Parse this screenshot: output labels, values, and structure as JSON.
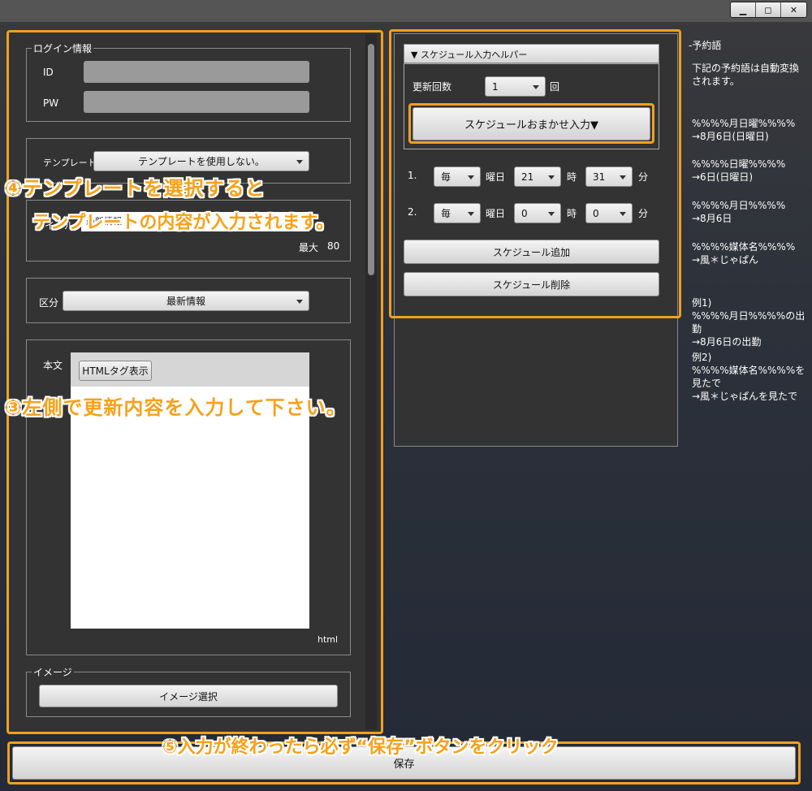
{
  "window": {
    "minimize": "▁",
    "maximize": "◻",
    "close": "✕"
  },
  "login": {
    "legend": "ログイン情報",
    "id_label": "ID",
    "pw_label": "PW"
  },
  "template": {
    "label": "テンプレート",
    "value": "テンプレートを使用しない。"
  },
  "title_field": {
    "label": "タイトル",
    "value": "最新情報",
    "max_label": "最大",
    "max_value": "80"
  },
  "category": {
    "label": "区分",
    "value": "最新情報"
  },
  "body": {
    "label": "本文",
    "html_button": "HTMLタグ表示",
    "mode": "html"
  },
  "image": {
    "legend": "イメージ",
    "select_button": "イメージ選択"
  },
  "helper": {
    "header": "スケジュール入力ヘルパー",
    "count_label": "更新回数",
    "count_value": "1",
    "count_unit": "回",
    "auto_button": "スケジュールおまかせ入力▼"
  },
  "schedule": {
    "rows": [
      {
        "num": "1.",
        "freq": "毎",
        "day_label": "曜日",
        "hour": "21",
        "hour_label": "時",
        "minute": "31",
        "minute_label": "分"
      },
      {
        "num": "2.",
        "freq": "毎",
        "day_label": "曜日",
        "hour": "0",
        "hour_label": "時",
        "minute": "0",
        "minute_label": "分"
      }
    ],
    "add_button": "スケジュール追加",
    "delete_button": "スケジュール削除"
  },
  "reserved": {
    "title": "-予約語",
    "description": "下記の予約語は自動変換されます。",
    "items": [
      {
        "word": "%%%%月日曜%%%%",
        "result": "→8月6日(日曜日)"
      },
      {
        "word": "%%%%日曜%%%%",
        "result": "→6日(日曜日)"
      },
      {
        "word": "%%%%月日%%%%",
        "result": "→8月6日"
      },
      {
        "word": "%%%%媒体名%%%%",
        "result": "→風＊じゃぱん"
      }
    ],
    "examples": [
      {
        "label": "例1)",
        "text": "%%%%月日%%%%の出勤",
        "result": "→8月6日の出勤"
      },
      {
        "label": "例2)",
        "text": "%%%%媒体名%%%%を見たで",
        "result": "→風＊じゃぱんを見たで"
      }
    ]
  },
  "save_button": "保存",
  "annotations": {
    "step4_line1": "④テンプレートを選択すると",
    "step4_line2": "テンプレートの内容が入力されます。",
    "step3": "③左側で更新内容を入力して下さい。",
    "step5": "⑤入力が終わったら必ず“保存”ボタンをクリック"
  },
  "colors": {
    "accent": "#f0a020",
    "panel": "#333333",
    "annotation": "#f7a11a"
  }
}
